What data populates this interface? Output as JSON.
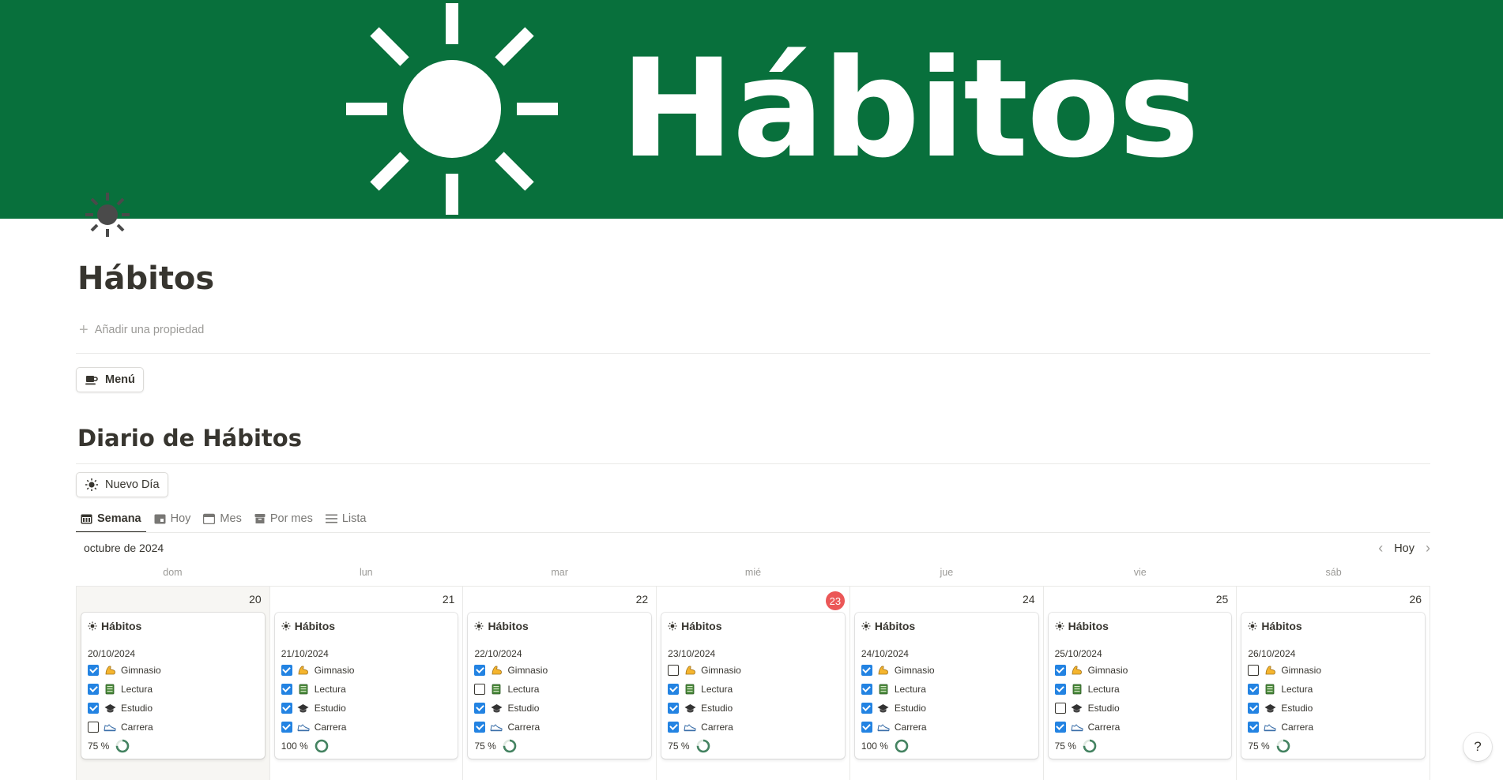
{
  "cover": {
    "title": "Hábitos",
    "background_color": "#08703c",
    "icon": "sun-icon"
  },
  "page": {
    "icon": "sun-icon",
    "title": "Hábitos",
    "add_property": "Añadir una propiedad"
  },
  "menu_button": {
    "icon": "coffee-icon",
    "label": "Menú"
  },
  "section": {
    "title": "Diario de Hábitos"
  },
  "nuevo_dia_button": {
    "icon": "sun-icon",
    "label": "Nuevo Día"
  },
  "tabs": [
    {
      "icon": "calendar-week-icon",
      "label": "Semana",
      "active": true
    },
    {
      "icon": "calendar-day-icon",
      "label": "Hoy",
      "active": false
    },
    {
      "icon": "calendar-month-icon",
      "label": "Mes",
      "active": false
    },
    {
      "icon": "archive-icon",
      "label": "Por mes",
      "active": false
    },
    {
      "icon": "list-icon",
      "label": "Lista",
      "active": false
    }
  ],
  "calendar": {
    "month_label": "octubre de 2024",
    "today_label": "Hoy",
    "weekdays": [
      "dom",
      "lun",
      "mar",
      "mié",
      "jue",
      "vie",
      "sáb"
    ],
    "days": [
      {
        "num": "20",
        "today": false,
        "card": {
          "title": "Hábitos",
          "date": "20/10/2024",
          "habits": [
            true,
            true,
            true,
            false
          ],
          "percent_label": "75 %",
          "percent": 75
        }
      },
      {
        "num": "21",
        "today": false,
        "card": {
          "title": "Hábitos",
          "date": "21/10/2024",
          "habits": [
            true,
            true,
            true,
            true
          ],
          "percent_label": "100 %",
          "percent": 100
        }
      },
      {
        "num": "22",
        "today": false,
        "card": {
          "title": "Hábitos",
          "date": "22/10/2024",
          "habits": [
            true,
            false,
            true,
            true
          ],
          "percent_label": "75 %",
          "percent": 75
        }
      },
      {
        "num": "23",
        "today": true,
        "card": {
          "title": "Hábitos",
          "date": "23/10/2024",
          "habits": [
            false,
            true,
            true,
            true
          ],
          "percent_label": "75 %",
          "percent": 75
        }
      },
      {
        "num": "24",
        "today": false,
        "card": {
          "title": "Hábitos",
          "date": "24/10/2024",
          "habits": [
            true,
            true,
            true,
            true
          ],
          "percent_label": "100 %",
          "percent": 100
        }
      },
      {
        "num": "25",
        "today": false,
        "card": {
          "title": "Hábitos",
          "date": "25/10/2024",
          "habits": [
            true,
            true,
            false,
            true
          ],
          "percent_label": "75 %",
          "percent": 75
        }
      },
      {
        "num": "26",
        "today": false,
        "card": {
          "title": "Hábitos",
          "date": "26/10/2024",
          "habits": [
            false,
            true,
            true,
            true
          ],
          "percent_label": "75 %",
          "percent": 75
        }
      }
    ],
    "habit_names": [
      "Gimnasio",
      "Lectura",
      "Estudio",
      "Carrera"
    ],
    "habit_icons": [
      "flexed-arm-icon",
      "book-icon",
      "graduation-cap-icon",
      "running-shoe-icon"
    ],
    "checkbox_color": "#2383e2",
    "today_badge_color": "#eb5757",
    "progress_ring_color": "#448361"
  },
  "help": {
    "label": "?"
  }
}
